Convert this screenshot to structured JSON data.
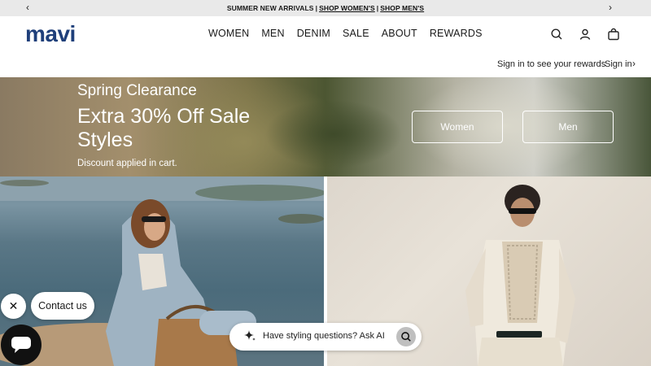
{
  "announcement": {
    "prefix": "SUMMER NEW ARRIVALS",
    "separator": "|",
    "link_women": "SHOP WOMEN'S",
    "link_men": "SHOP MEN'S",
    "prev_arrow": "‹",
    "next_arrow": "›"
  },
  "header": {
    "logo": "mavi",
    "nav": [
      "WOMEN",
      "MEN",
      "DENIM",
      "SALE",
      "ABOUT",
      "REWARDS"
    ],
    "icons": [
      "search-icon",
      "account-icon",
      "bag-icon"
    ],
    "brand_color": "#1f3f7a"
  },
  "subheader": {
    "rewards_link": "Sign in to see your rewards",
    "signin_link": "Sign in",
    "chevron": "›"
  },
  "hero": {
    "eyebrow": "Spring Clearance",
    "headline": "Extra 30% Off Sale Styles",
    "note": "Discount applied in cart.",
    "buttons": [
      "Women",
      "Men"
    ]
  },
  "widgets": {
    "close_glyph": "✕",
    "contact_label": "Contact us",
    "ai_placeholder": "Have styling questions? Ask AI"
  }
}
